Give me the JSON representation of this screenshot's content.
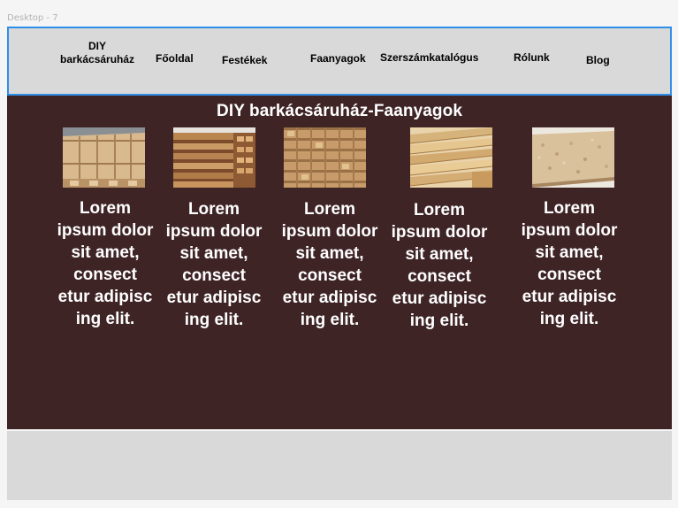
{
  "frame_label": "Desktop - 7",
  "nav": {
    "brand_line1": "DIY",
    "brand_line2": "barkácsáruház",
    "items": [
      {
        "label": "Főoldal"
      },
      {
        "label": "Festékek"
      },
      {
        "label": "Faanyagok"
      },
      {
        "label": "Szerszámkatalógus"
      },
      {
        "label": "Rólunk"
      },
      {
        "label": "Blog"
      }
    ]
  },
  "main": {
    "title": "DIY barkácsáruház-Faanyagok",
    "cards": [
      {
        "image": "stacked-lumber-boards",
        "text": "Lorem ipsum dolor sit amet, consect etur adipisc ing elit."
      },
      {
        "image": "stacked-timber-pile",
        "text": "Lorem ipsum dolor sit amet, consect etur adipisc ing elit."
      },
      {
        "image": "timber-beams-stack",
        "text": "Lorem ipsum dolor sit amet, consect etur adipisc ing elit."
      },
      {
        "image": "planed-planks-stack",
        "text": "Lorem ipsum dolor sit amet, consect etur adipisc ing elit."
      },
      {
        "image": "osb-board",
        "text": "Lorem ipsum dolor sit amet, consect etur adipisc ing elit."
      }
    ]
  },
  "colors": {
    "nav_background": "#d9d9d9",
    "nav_border": "#2f8ee8",
    "content_background": "#3f2426",
    "text_light": "#ffffff"
  }
}
